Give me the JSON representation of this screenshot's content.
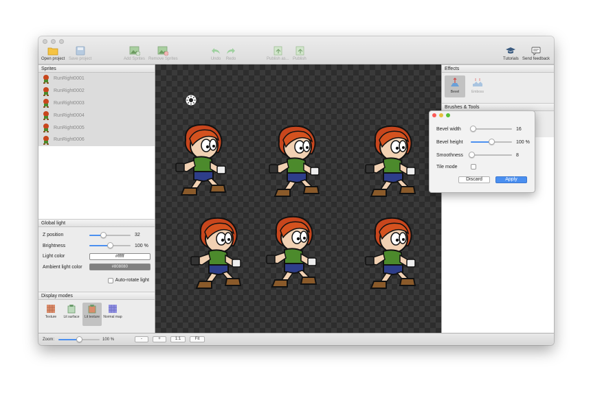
{
  "toolbar": {
    "open_project": "Open project",
    "save_project": "Save project",
    "add_sprites": "Add Sprites",
    "remove_sprites": "Remove Sprites",
    "undo": "Undo",
    "redo": "Redo",
    "publish_as": "Publish as...",
    "publish": "Publish",
    "tutorials": "Tutorials",
    "send_feedback": "Send feedback"
  },
  "sprites": {
    "header": "Sprites",
    "items": [
      "RunRight0001",
      "RunRight0002",
      "RunRight0003",
      "RunRight0004",
      "RunRight0005",
      "RunRight0006"
    ]
  },
  "global_light": {
    "header": "Global light",
    "z_position_label": "Z position",
    "z_position_value": "32",
    "z_position_fraction": 0.34,
    "brightness_label": "Brightness",
    "brightness_value": "100 %",
    "brightness_fraction": 0.5,
    "light_color_label": "Light color",
    "light_color_value": "#ffffff",
    "ambient_label": "Ambient light color",
    "ambient_value": "#808080",
    "auto_rotate_label": "Auto-rotate light"
  },
  "display_modes": {
    "header": "Display modes",
    "texture": "Texture",
    "lit_surface": "Lit surface",
    "lit_texture": "Lit texture",
    "normal_map": "Normal map"
  },
  "effects": {
    "header": "Effects",
    "bevel": "Bevel",
    "emboss": "Emboss"
  },
  "brushes": {
    "header": "Brushes & Tools"
  },
  "bevel_dialog": {
    "bevel_width_label": "Bevel width",
    "bevel_width_value": "16",
    "bevel_width_fraction": 0.05,
    "bevel_height_label": "Bevel height",
    "bevel_height_value": "100 %",
    "bevel_height_fraction": 0.5,
    "smoothness_label": "Smoothness",
    "smoothness_value": "8",
    "smoothness_fraction": 0.02,
    "tile_mode_label": "Tile mode",
    "discard": "Discard",
    "apply": "Apply"
  },
  "status": {
    "zoom_label": "Zoom:",
    "zoom_value": "100 %",
    "zoom_fraction": 0.5,
    "minus": "-",
    "plus": "+",
    "one_to_one": "1:1",
    "fit": "Fit"
  },
  "colors": {
    "accent": "#4a8ff0",
    "canvas_dark": "#2d2d2d",
    "canvas_light": "#3a3a3a",
    "hair": "#c8461d",
    "shirt": "#4c8a2c",
    "close": "#fc5b57",
    "minimize": "#e5bf3c",
    "zoom": "#57c038"
  }
}
